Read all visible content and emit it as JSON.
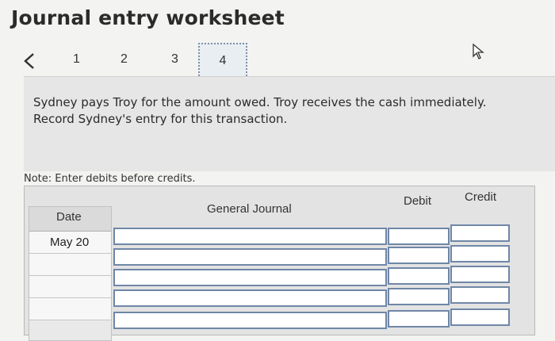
{
  "header": {
    "title": "Journal entry worksheet"
  },
  "steps": {
    "prev_label": "<",
    "items": [
      "1",
      "2",
      "3",
      "4"
    ],
    "active": "4"
  },
  "prompt": {
    "line1": "Sydney pays Troy for the amount owed. Troy receives the cash immediately.",
    "line2": "Record Sydney's entry for this transaction."
  },
  "note": "Note: Enter debits before credits.",
  "table": {
    "headers": {
      "date": "Date",
      "journal": "General Journal",
      "debit": "Debit",
      "credit": "Credit"
    },
    "rows": [
      {
        "date": "May 20"
      },
      {
        "date": ""
      },
      {
        "date": ""
      },
      {
        "date": ""
      },
      {
        "date": ""
      }
    ]
  },
  "icons": {
    "prev": "chevron-left-icon",
    "cursor": "mouse-cursor-icon"
  }
}
